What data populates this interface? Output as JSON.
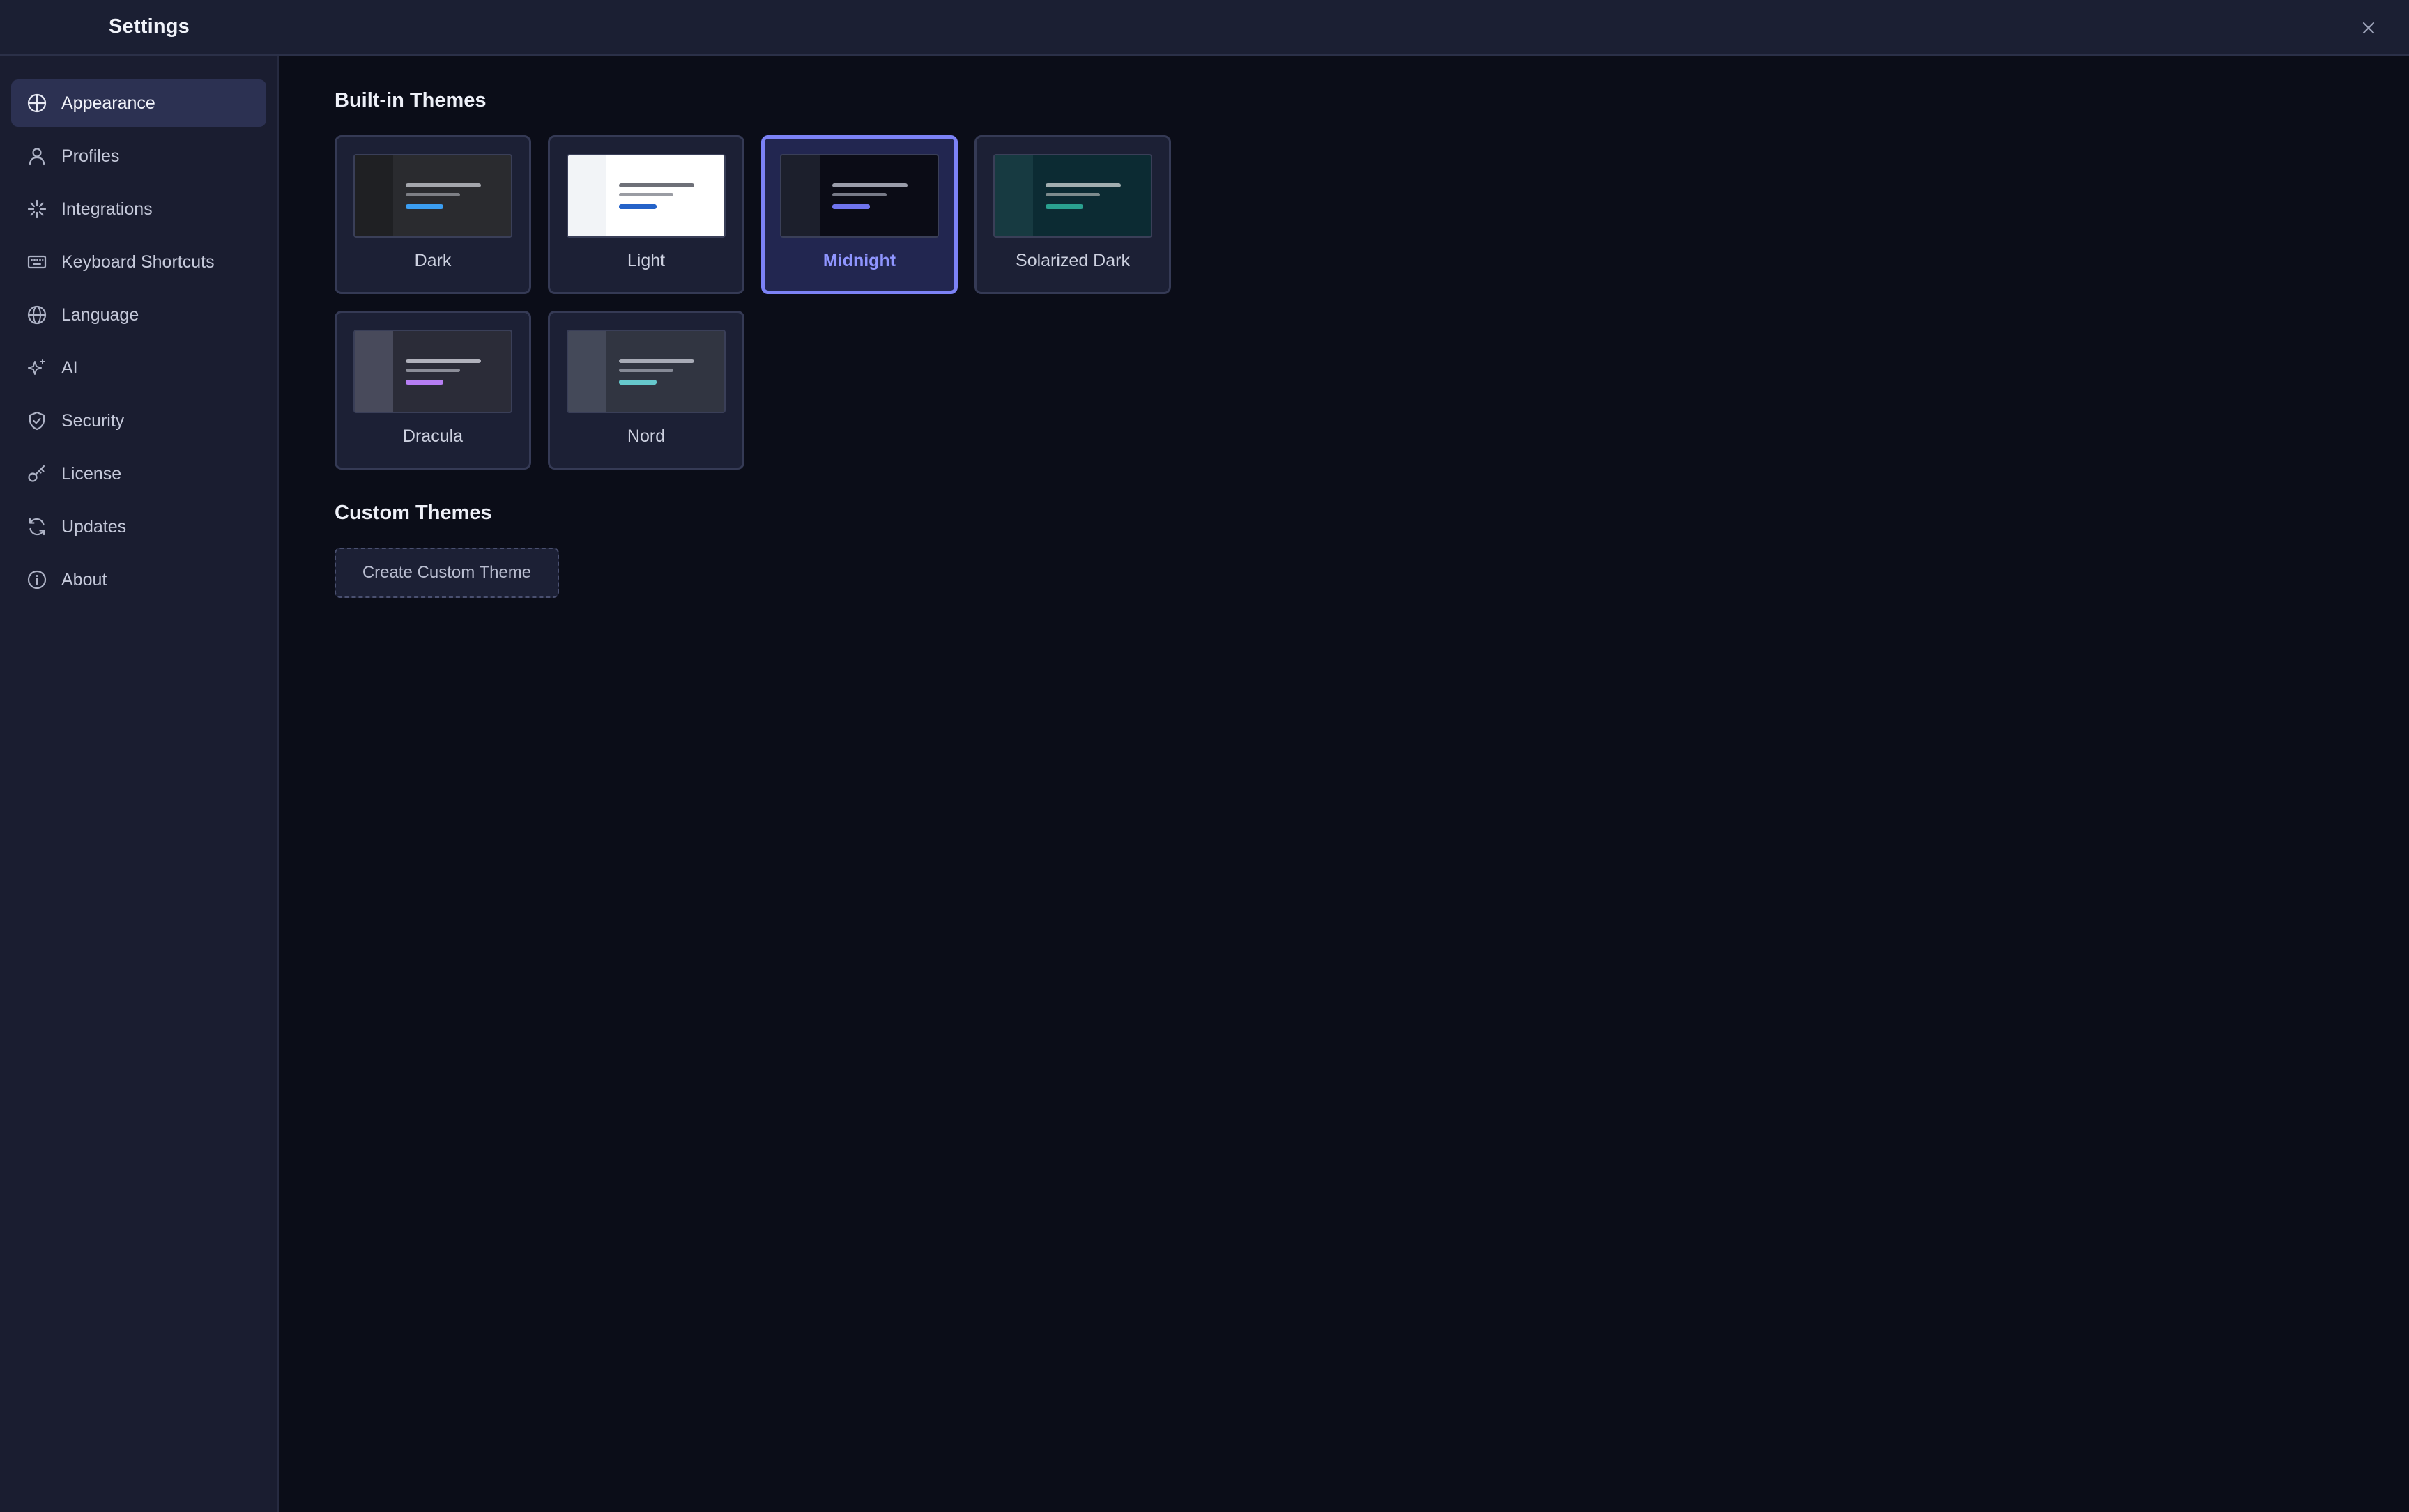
{
  "window": {
    "title": "Settings"
  },
  "sidebar": {
    "items": [
      {
        "label": "Appearance",
        "icon": "palette-icon",
        "active": true
      },
      {
        "label": "Profiles",
        "icon": "user-icon"
      },
      {
        "label": "Integrations",
        "icon": "sparkle-burst-icon"
      },
      {
        "label": "Keyboard Shortcuts",
        "icon": "keyboard-icon"
      },
      {
        "label": "Language",
        "icon": "globe-icon"
      },
      {
        "label": "AI",
        "icon": "ai-sparkles-icon"
      },
      {
        "label": "Security",
        "icon": "shield-icon"
      },
      {
        "label": "License",
        "icon": "key-icon"
      },
      {
        "label": "Updates",
        "icon": "refresh-icon"
      },
      {
        "label": "About",
        "icon": "info-icon"
      }
    ]
  },
  "main": {
    "builtin_title": "Built-in Themes",
    "themes": [
      {
        "name": "Dark",
        "selected": false,
        "colors": {
          "bg": "#2a2b2f",
          "side": "#1f2023",
          "l1": "#a4a6ac",
          "l2": "#7d7f85",
          "accent": "#3b9ef2"
        }
      },
      {
        "name": "Light",
        "selected": false,
        "colors": {
          "bg": "#ffffff",
          "side": "#f2f4f7",
          "l1": "#6e7078",
          "l2": "#9a9ca3",
          "accent": "#2563c9"
        }
      },
      {
        "name": "Midnight",
        "selected": true,
        "colors": {
          "bg": "#0b0c16",
          "side": "#1c1f2c",
          "l1": "#9a9daa",
          "l2": "#777a87",
          "accent": "#6f74ee"
        }
      },
      {
        "name": "Solarized Dark",
        "selected": false,
        "colors": {
          "bg": "#0c2b33",
          "side": "#173a41",
          "l1": "#a2aeb0",
          "l2": "#7d8b8d",
          "accent": "#2aa18f"
        }
      },
      {
        "name": "Dracula",
        "selected": false,
        "colors": {
          "bg": "#2b2c38",
          "side": "#484a5b",
          "l1": "#b0b1bb",
          "l2": "#8b8d98",
          "accent": "#b67ef3"
        }
      },
      {
        "name": "Nord",
        "selected": false,
        "colors": {
          "bg": "#313541",
          "side": "#444959",
          "l1": "#a8abb6",
          "l2": "#868a96",
          "accent": "#66c8cc"
        }
      }
    ],
    "custom_title": "Custom Themes",
    "create_label": "Create Custom Theme"
  }
}
